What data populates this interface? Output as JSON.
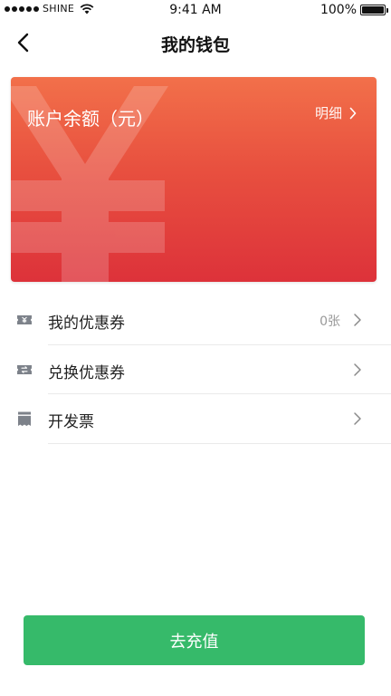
{
  "status_bar": {
    "carrier": "SHINE",
    "time": "9:41 AM",
    "battery": "100%",
    "battery_level": 1.0
  },
  "nav": {
    "title": "我的钱包",
    "back_icon": "chevron-left-icon"
  },
  "balance_card": {
    "title": "账户余额（元）",
    "detail_label": "明细",
    "watermark_icon": "yen-icon",
    "gradient_colors": [
      "#f2704a",
      "#dd323a"
    ]
  },
  "menu": {
    "items": [
      {
        "label": "我的优惠券",
        "value": "0张",
        "icon": "coupon-icon"
      },
      {
        "label": "兑换优惠券",
        "value": "",
        "icon": "coupon-exchange-icon"
      },
      {
        "label": "开发票",
        "value": "",
        "icon": "invoice-icon"
      }
    ]
  },
  "actions": {
    "recharge_label": "去充值",
    "recharge_color": "#36ba6a"
  }
}
